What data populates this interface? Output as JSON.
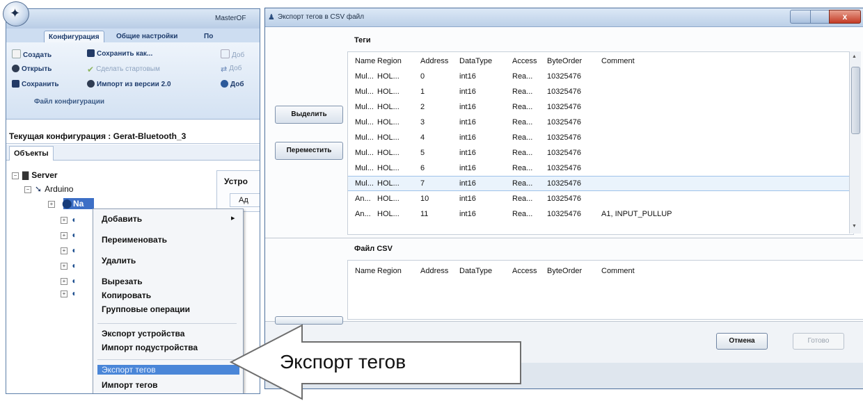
{
  "left_window": {
    "title": "MasterOF",
    "ribbon_tabs": [
      "Конфигурация",
      "Общие настройки",
      "По"
    ],
    "ribbon_buttons": {
      "create": "Создать",
      "open": "Открыть",
      "save": "Сохранить",
      "save_as": "Сохранить как...",
      "make_startup": "Сделать стартовым",
      "import_v2": "Импорт из версии 2.0",
      "add1": "Доб",
      "add2": "Доб",
      "add3": "Доб"
    },
    "ribbon_group_label": "Файл конфигурации",
    "current_config": "Текущая конфигурация : Gerat-Bluetooth_3",
    "objects_tab": "Объекты",
    "tree": {
      "server": "Server",
      "arduino": "Arduino",
      "selected_node": "Na"
    },
    "right_panel_label": "Устро",
    "right_panel_sub": "Ад",
    "context_menu": [
      "Добавить",
      "Переименовать",
      "Удалить",
      "Вырезать",
      "Копировать",
      "Групповые операции",
      "Экспорт устройства",
      "Импорт подустройства",
      "Экспорт тегов",
      "Импорт тегов"
    ],
    "submenu_arrow": "▸"
  },
  "dialog": {
    "title": "Экспорт тегов в CSV файл",
    "close_glyph": "x",
    "button_select": "Выделить",
    "button_move": "Переместить",
    "tags_label": "Теги",
    "csv_label": "Файл CSV",
    "columns": [
      "Name",
      "Region",
      "Address",
      "DataType",
      "Access",
      "ByteOrder",
      "Comment"
    ],
    "rows": [
      [
        "Mul...",
        "HOL...",
        "0",
        "int16",
        "Rea...",
        "10325476",
        ""
      ],
      [
        "Mul...",
        "HOL...",
        "1",
        "int16",
        "Rea...",
        "10325476",
        ""
      ],
      [
        "Mul...",
        "HOL...",
        "2",
        "int16",
        "Rea...",
        "10325476",
        ""
      ],
      [
        "Mul...",
        "HOL...",
        "3",
        "int16",
        "Rea...",
        "10325476",
        ""
      ],
      [
        "Mul...",
        "HOL...",
        "4",
        "int16",
        "Rea...",
        "10325476",
        ""
      ],
      [
        "Mul...",
        "HOL...",
        "5",
        "int16",
        "Rea...",
        "10325476",
        ""
      ],
      [
        "Mul...",
        "HOL...",
        "6",
        "int16",
        "Rea...",
        "10325476",
        ""
      ],
      [
        "Mul...",
        "HOL...",
        "7",
        "int16",
        "Rea...",
        "10325476",
        ""
      ],
      [
        "An...",
        "HOL...",
        "10",
        "int16",
        "Rea...",
        "10325476",
        ""
      ],
      [
        "An...",
        "HOL...",
        "11",
        "int16",
        "Rea...",
        "10325476",
        "A1, INPUT_PULLUP"
      ]
    ],
    "selected_row_index": 7,
    "button_cancel": "Отмена",
    "button_done": "Готово"
  },
  "callout": {
    "text": "Экспорт тегов"
  }
}
